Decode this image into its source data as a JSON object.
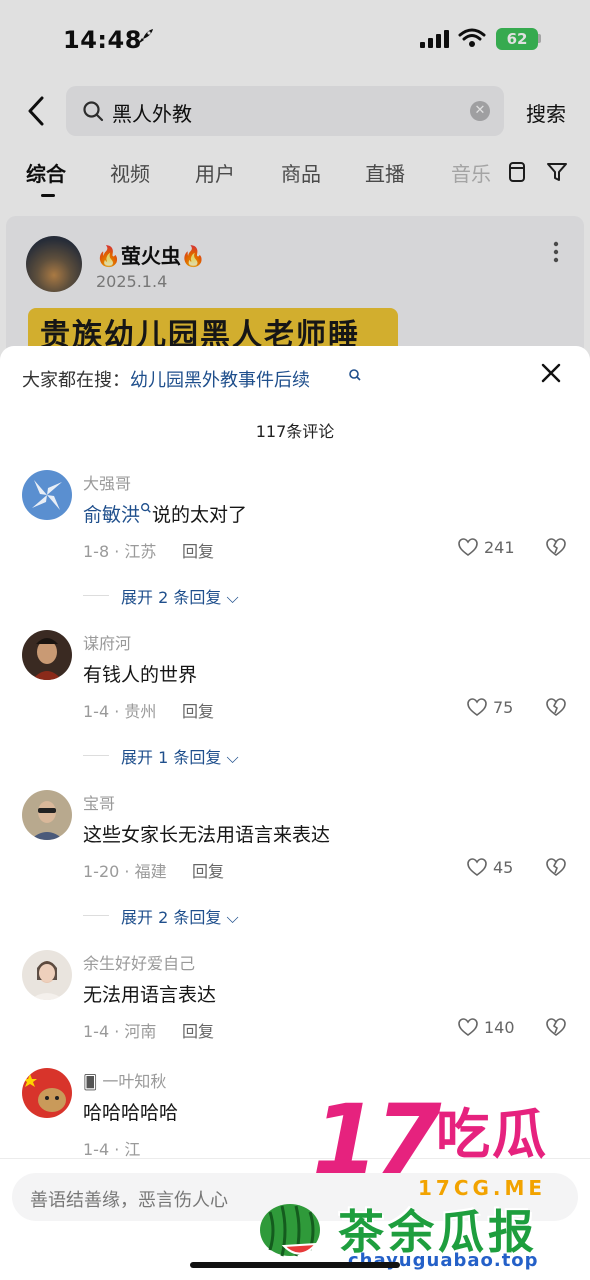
{
  "status": {
    "time": "14:48",
    "battery": "62"
  },
  "search": {
    "query": "黑人外教",
    "button_label": "搜索"
  },
  "tabs": [
    {
      "label": "综合",
      "active": true
    },
    {
      "label": "视频"
    },
    {
      "label": "用户"
    },
    {
      "label": "商品"
    },
    {
      "label": "直播"
    },
    {
      "label": "音乐"
    }
  ],
  "card": {
    "author": "萤火虫",
    "date": "2025.1.4",
    "thumb_text": "贵族幼儿园黑人老师睡"
  },
  "sheet": {
    "hot_prefix": "大家都在搜：",
    "hot_query": "幼儿园黑外教事件后续",
    "count_label": "117条评论",
    "reply_label": "回复"
  },
  "comments": [
    {
      "user": "大强哥",
      "mention": "俞敏洪",
      "text": "说的太对了",
      "meta": "1-8 · 江苏",
      "likes": "241",
      "expand": "展开 2 条回复"
    },
    {
      "user": "谋府河",
      "mention": "",
      "text": "有钱人的世界",
      "meta": "1-4 · 贵州",
      "likes": "75",
      "expand": "展开 1 条回复"
    },
    {
      "user": "宝哥",
      "mention": "",
      "text": "这些女家长无法用语言来表达",
      "meta": "1-20 · 福建",
      "likes": "45",
      "expand": "展开 2 条回复"
    },
    {
      "user": "余生好好爱自己",
      "mention": "",
      "text": "无法用语言表达",
      "meta": "1-4 · 河南",
      "likes": "140",
      "expand": ""
    },
    {
      "user": "一叶知秋",
      "mention": "",
      "text": "哈哈哈哈哈",
      "meta": "1-4 · 江",
      "likes": "",
      "expand": ""
    }
  ],
  "input": {
    "placeholder": "善语结善缘，恶言伤人心"
  },
  "watermark": {
    "big": "17",
    "gua": "吃瓜",
    "site1": "17CG.ME",
    "title": "茶余瓜报",
    "site2": "chayuguabao.top"
  },
  "colors": {
    "link": "#1f4f8c",
    "watermark_pink": "#e6227e",
    "watermark_green": "#1e9e3e"
  }
}
